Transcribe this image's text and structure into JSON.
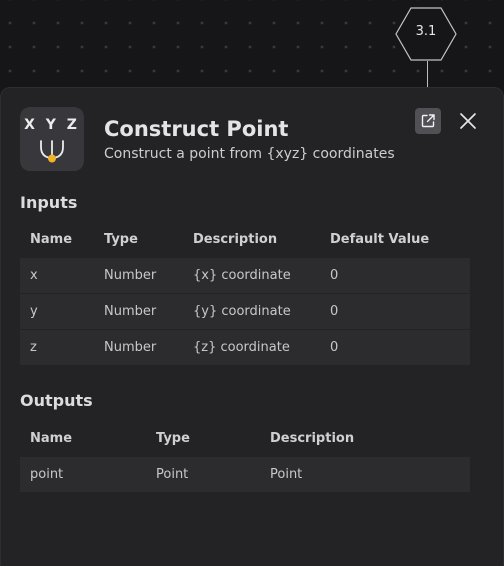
{
  "version_badge": "3.1",
  "node": {
    "icon_text": "X Y Z",
    "title": "Construct Point",
    "subtitle": "Construct a point from {xyz} coordinates"
  },
  "inputs": {
    "heading": "Inputs",
    "columns": [
      "Name",
      "Type",
      "Description",
      "Default Value"
    ],
    "rows": [
      {
        "name": "x",
        "type": "Number",
        "description": "{x} coordinate",
        "default": "0"
      },
      {
        "name": "y",
        "type": "Number",
        "description": "{y} coordinate",
        "default": "0"
      },
      {
        "name": "z",
        "type": "Number",
        "description": "{z} coordinate",
        "default": "0"
      }
    ]
  },
  "outputs": {
    "heading": "Outputs",
    "columns": [
      "Name",
      "Type",
      "Description"
    ],
    "rows": [
      {
        "name": "point",
        "type": "Point",
        "description": "Point"
      }
    ]
  },
  "icons": {
    "open": "external-link-icon",
    "close": "close-icon",
    "node": "construct-point-node-icon"
  },
  "colors": {
    "accent": "#f0b42a",
    "panel": "#232325",
    "row": "#2c2c2f",
    "background": "#161618"
  }
}
